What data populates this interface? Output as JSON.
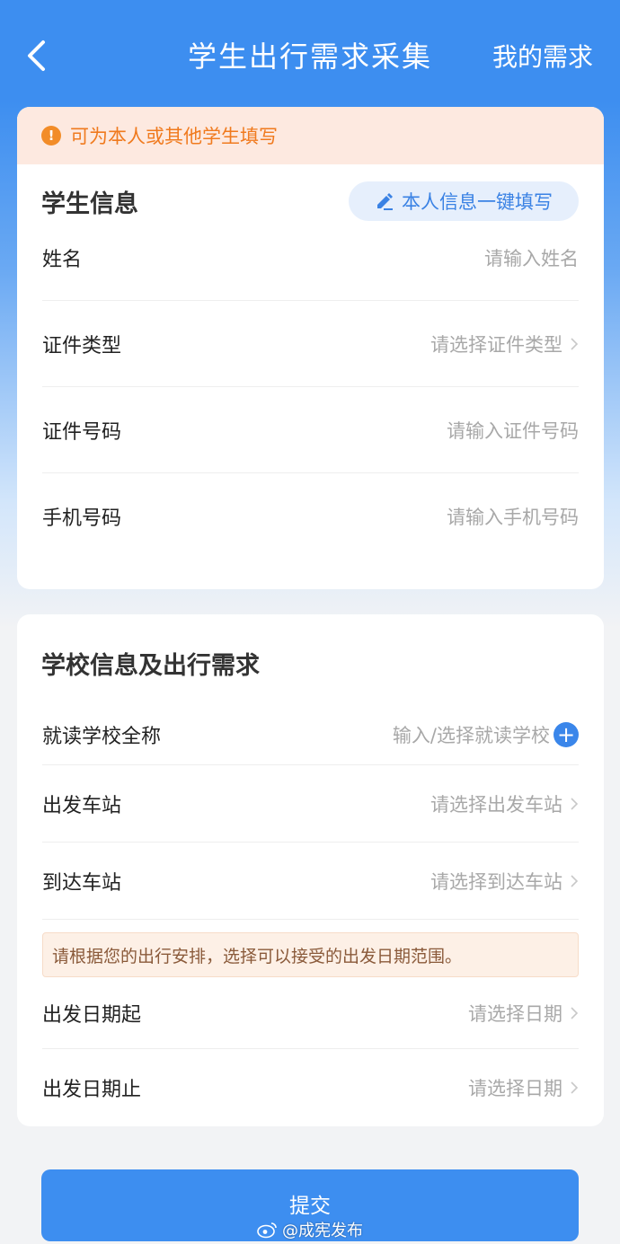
{
  "header": {
    "title": "学生出行需求采集",
    "right_link": "我的需求",
    "back_icon": "chevron-left-icon"
  },
  "student_card": {
    "notice": "可为本人或其他学生填写",
    "section_title": "学生信息",
    "autofill_label": "本人信息一键填写",
    "fields": [
      {
        "label": "姓名",
        "placeholder": "请输入姓名"
      },
      {
        "label": "证件类型",
        "placeholder": "请选择证件类型"
      },
      {
        "label": "证件号码",
        "placeholder": "请输入证件号码"
      },
      {
        "label": "手机号码",
        "placeholder": "请输入手机号码"
      }
    ]
  },
  "school_card": {
    "section_title": "学校信息及出行需求",
    "fields": [
      {
        "label": "就读学校全称",
        "placeholder": "输入/选择就读学校"
      },
      {
        "label": "出发车站",
        "placeholder": "请选择出发车站"
      },
      {
        "label": "到达车站",
        "placeholder": "请选择到达车站"
      }
    ],
    "hint": "请根据您的出行安排，选择可以接受的出发日期范围。",
    "date_fields": [
      {
        "label": "出发日期起",
        "placeholder": "请选择日期"
      },
      {
        "label": "出发日期止",
        "placeholder": "请选择日期"
      }
    ]
  },
  "submit_label": "提交",
  "watermark": "@成宪发布",
  "colors": {
    "primary": "#3d8ef0",
    "notice_text": "#f07a1e",
    "notice_bg": "#fde9e0",
    "placeholder": "#a8a8a8"
  }
}
